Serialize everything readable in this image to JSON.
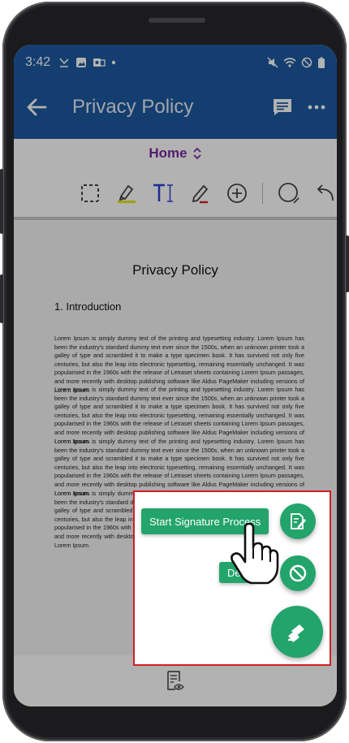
{
  "status_bar": {
    "time": "3:42"
  },
  "header": {
    "title": "Privacy Policy"
  },
  "mode": {
    "label": "Home"
  },
  "document": {
    "title": "Privacy Policy",
    "section_heading": "1. Introduction",
    "paragraphs": [
      "Lorem Ipsum is simply dummy text of the printing and typesetting industry. Lorem Ipsum has been the industry's standard dummy text ever since the 1500s, when an unknown printer took a galley of type and scrambled it to make a type specimen book. It has survived not only five centuries, but also the leap into electronic typesetting, remaining essentially unchanged. It was popularised in the 1960s with the release of Letraset sheets containing Lorem Ipsum passages, and more recently with desktop publishing software like Aldus PageMaker including versions of Lorem Ipsum.",
      "Lorem Ipsum is simply dummy text of the printing and typesetting industry. Lorem Ipsum has been the industry's standard dummy text ever since the 1500s, when an unknown printer took a galley of type and scrambled it to make a type specimen book. It has survived not only five centuries, but also the leap into electronic typesetting, remaining essentially unchanged. It was popularised in the 1960s with the release of Letraset sheets containing Lorem Ipsum passages, and more recently with desktop publishing software like Aldus PageMaker including versions of Lorem Ipsum.",
      "Lorem Ipsum is simply dummy text of the printing and typesetting industry. Lorem Ipsum has been the industry's standard dummy text ever since the 1500s, when an unknown printer took a galley of type and scrambled it to make a type specimen book. It has survived not only five centuries, but also the leap into electronic typesetting, remaining essentially unchanged. It was popularised in the 1960s with the release of Letraset sheets containing Lorem Ipsum passages, and more recently with desktop publishing software like Aldus PageMaker including versions of Lorem Ipsum.",
      "Lorem Ipsum is simply dummy text of the printing and typesetting industry. Lorem Ipsum has been the industry's standard dummy text ever since the 1500s, when an unknown printer took a galley of type and scrambled it to make a type specimen book. It has survived not only five centuries, but also the leap into electronic typesetting, remaining essentially unchanged. It was popularised in the 1960s with the release of Letraset sheets containing Lorem Ipsum passages, and more recently with desktop publishing software like Aldus PageMaker including versions of Lorem Ipsum."
    ]
  },
  "speed_dial": {
    "start_signature_label": "Start Signature Process",
    "decline_label": "Dec"
  },
  "colors": {
    "app_bar": "#1e5aa0",
    "mode_label": "#7a2aa0",
    "fab_green": "#23a46b",
    "highlight_border": "#d11f25"
  },
  "icons": {
    "back": "arrow-left-icon",
    "comments": "comment-icon",
    "more": "more-horizontal-icon",
    "select": "dashed-select-icon",
    "highlighter": "highlighter-icon",
    "text": "text-tool-icon",
    "pen": "pen-icon",
    "add": "add-circle-icon",
    "shape": "circle-shape-icon",
    "undo": "undo-icon",
    "sign": "sign-document-icon",
    "decline": "block-icon",
    "signature_menu": "signature-menu-icon",
    "view_doc": "document-view-icon",
    "pointer": "hand-pointer-icon"
  }
}
